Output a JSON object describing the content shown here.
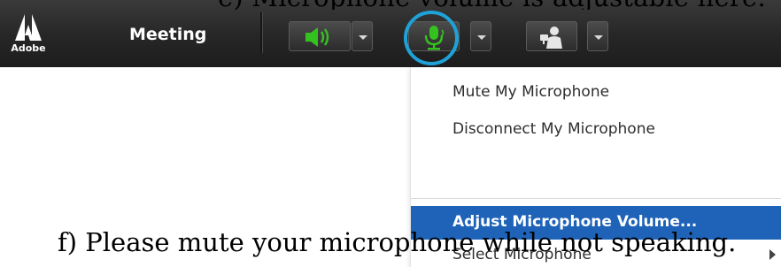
{
  "caption_top": "e) Microphone volume is adjustable here:",
  "caption_bottom": "f) Please mute your microphone while not speaking.",
  "logo": {
    "text": "Adobe"
  },
  "toolbar": {
    "title": "Meeting",
    "speaker_icon": "speaker-volume-icon",
    "microphone_icon": "microphone-icon",
    "camera_icon": "webcam-user-icon",
    "active_icon_color": "#34c21f",
    "highlight_ring_color": "#1ea2d8"
  },
  "menu": {
    "items": [
      "Mute My Microphone",
      "Disconnect My Microphone",
      "Adjust Microphone Volume...",
      "Select Microphone"
    ],
    "highlighted_index": 2,
    "highlight_color": "#1f63b8"
  }
}
